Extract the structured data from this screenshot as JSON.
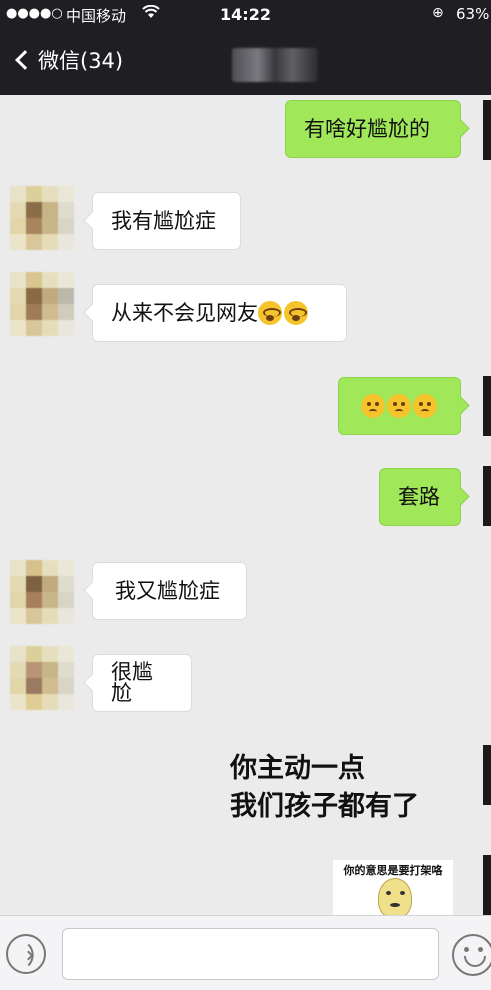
{
  "status_bar": {
    "signal": "●●●●○",
    "carrier": "中国移动",
    "wifi_icon": "wifi-icon",
    "time": "14:22",
    "battery": "63%"
  },
  "nav": {
    "back_label": "微信(34)"
  },
  "messages": [
    {
      "side": "right",
      "text": "有啥好尴尬的"
    },
    {
      "side": "left",
      "text": "我有尴尬症"
    },
    {
      "side": "left",
      "text": "从来不会见网友",
      "emojis": [
        "shock",
        "shock"
      ]
    },
    {
      "side": "right",
      "text": "",
      "emojis": [
        "puzzle",
        "puzzle",
        "puzzle"
      ]
    },
    {
      "side": "right",
      "text": "套路"
    },
    {
      "side": "left",
      "text": "我又尴尬症"
    },
    {
      "side": "left",
      "text": "很尴尬"
    }
  ],
  "meme": {
    "line1": "你主动一点",
    "line2": "我们孩子都有了"
  },
  "sticker": {
    "caption": "你的意思是要打架咯"
  },
  "colors": {
    "sent_bubble": "#a0e75a",
    "received_bubble": "#ffffff",
    "nav_bg": "#1f1f23",
    "chat_bg": "#ebebeb"
  }
}
